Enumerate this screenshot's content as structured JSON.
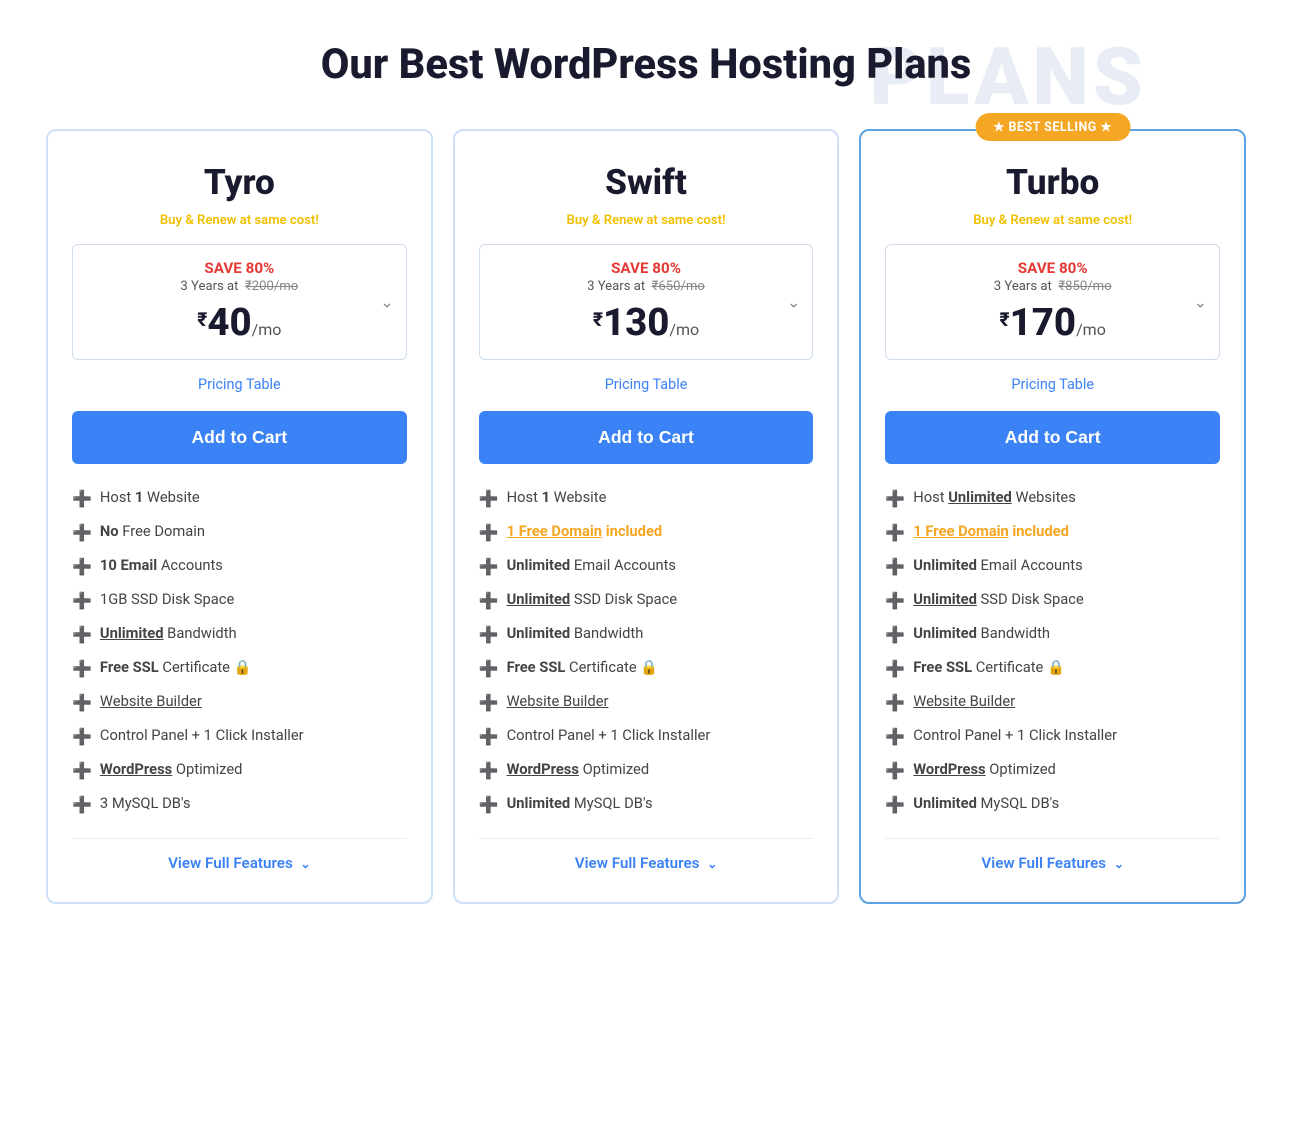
{
  "page": {
    "title": "Our Best WordPress Hosting Plans",
    "title_bg": "PLANS"
  },
  "plans": [
    {
      "id": "tyro",
      "name": "Tyro",
      "buy_renew": "Buy & Renew at same cost!",
      "save_label": "SAVE 80%",
      "years": "3 Years at",
      "original_price": "₹200/mo",
      "current_price": "40",
      "currency": "₹",
      "per_mo": "/mo",
      "pricing_table_label": "Pricing Table",
      "add_to_cart": "Add to Cart",
      "view_features": "View Full Features",
      "featured": false,
      "features": [
        {
          "text_parts": [
            {
              "text": "Host ",
              "style": "normal"
            },
            {
              "text": "1",
              "style": "bold"
            },
            {
              "text": " Website",
              "style": "normal"
            }
          ]
        },
        {
          "text_parts": [
            {
              "text": "No",
              "style": "bold"
            },
            {
              "text": " Free Domain",
              "style": "normal"
            }
          ]
        },
        {
          "text_parts": [
            {
              "text": "10 Email",
              "style": "bold"
            },
            {
              "text": " Accounts",
              "style": "normal"
            }
          ]
        },
        {
          "text_parts": [
            {
              "text": "1GB",
              "style": "normal"
            },
            {
              "text": " SSD Disk Space",
              "style": "normal"
            }
          ]
        },
        {
          "text_parts": [
            {
              "text": "Unlimited",
              "style": "bold-link"
            },
            {
              "text": " Bandwidth",
              "style": "normal"
            }
          ]
        },
        {
          "text_parts": [
            {
              "text": "Free SSL",
              "style": "bold"
            },
            {
              "text": " Certificate ",
              "style": "normal"
            },
            {
              "text": "🔒",
              "style": "icon"
            }
          ]
        },
        {
          "text_parts": [
            {
              "text": "Website Builder",
              "style": "link"
            }
          ]
        },
        {
          "text_parts": [
            {
              "text": "Control Panel + 1 Click Installer",
              "style": "normal"
            }
          ]
        },
        {
          "text_parts": [
            {
              "text": "WordPress",
              "style": "bold-link"
            },
            {
              "text": " Optimized",
              "style": "normal"
            }
          ]
        },
        {
          "text_parts": [
            {
              "text": "3",
              "style": "normal"
            },
            {
              "text": " MySQL DB's",
              "style": "normal"
            }
          ]
        }
      ]
    },
    {
      "id": "swift",
      "name": "Swift",
      "buy_renew": "Buy & Renew at same cost!",
      "save_label": "SAVE 80%",
      "years": "3 Years at",
      "original_price": "₹650/mo",
      "current_price": "130",
      "currency": "₹",
      "per_mo": "/mo",
      "pricing_table_label": "Pricing Table",
      "add_to_cart": "Add to Cart",
      "view_features": "View Full Features",
      "featured": false,
      "features": [
        {
          "text_parts": [
            {
              "text": "Host ",
              "style": "normal"
            },
            {
              "text": "1",
              "style": "bold"
            },
            {
              "text": " Website",
              "style": "normal"
            }
          ]
        },
        {
          "text_parts": [
            {
              "text": "1 Free Domain",
              "style": "orange-link"
            },
            {
              "text": " included",
              "style": "orange"
            }
          ]
        },
        {
          "text_parts": [
            {
              "text": "Unlimited",
              "style": "bold"
            },
            {
              "text": " Email Accounts",
              "style": "normal"
            }
          ]
        },
        {
          "text_parts": [
            {
              "text": "Unlimited",
              "style": "bold-link"
            },
            {
              "text": " SSD Disk Space",
              "style": "normal"
            }
          ]
        },
        {
          "text_parts": [
            {
              "text": "Unlimited",
              "style": "bold"
            },
            {
              "text": " Bandwidth",
              "style": "normal"
            }
          ]
        },
        {
          "text_parts": [
            {
              "text": "Free SSL",
              "style": "bold"
            },
            {
              "text": " Certificate ",
              "style": "normal"
            },
            {
              "text": "🔒",
              "style": "icon"
            }
          ]
        },
        {
          "text_parts": [
            {
              "text": "Website Builder",
              "style": "link"
            }
          ]
        },
        {
          "text_parts": [
            {
              "text": "Control Panel + 1 Click Installer",
              "style": "normal"
            }
          ]
        },
        {
          "text_parts": [
            {
              "text": "WordPress",
              "style": "bold-link"
            },
            {
              "text": " Optimized",
              "style": "normal"
            }
          ]
        },
        {
          "text_parts": [
            {
              "text": "Unlimited",
              "style": "bold"
            },
            {
              "text": " MySQL DB's",
              "style": "normal"
            }
          ]
        }
      ]
    },
    {
      "id": "turbo",
      "name": "Turbo",
      "buy_renew": "Buy & Renew at same cost!",
      "save_label": "SAVE 80%",
      "years": "3 Years at",
      "original_price": "₹850/mo",
      "current_price": "170",
      "currency": "₹",
      "per_mo": "/mo",
      "pricing_table_label": "Pricing Table",
      "add_to_cart": "Add to Cart",
      "view_features": "View Full Features",
      "featured": true,
      "best_selling_label": "★  BEST SELLING  ★",
      "features": [
        {
          "text_parts": [
            {
              "text": "Host ",
              "style": "normal"
            },
            {
              "text": "Unlimited",
              "style": "bold-link"
            },
            {
              "text": " Websites",
              "style": "normal"
            }
          ]
        },
        {
          "text_parts": [
            {
              "text": "1 Free Domain",
              "style": "orange-link"
            },
            {
              "text": " included",
              "style": "orange"
            }
          ]
        },
        {
          "text_parts": [
            {
              "text": "Unlimited",
              "style": "bold"
            },
            {
              "text": " Email Accounts",
              "style": "normal"
            }
          ]
        },
        {
          "text_parts": [
            {
              "text": "Unlimited",
              "style": "bold-link"
            },
            {
              "text": " SSD Disk Space",
              "style": "normal"
            }
          ]
        },
        {
          "text_parts": [
            {
              "text": "Unlimited",
              "style": "bold"
            },
            {
              "text": " Bandwidth",
              "style": "normal"
            }
          ]
        },
        {
          "text_parts": [
            {
              "text": "Free SSL",
              "style": "bold"
            },
            {
              "text": " Certificate ",
              "style": "normal"
            },
            {
              "text": "🔒",
              "style": "icon"
            }
          ]
        },
        {
          "text_parts": [
            {
              "text": "Website Builder",
              "style": "link"
            }
          ]
        },
        {
          "text_parts": [
            {
              "text": "Control Panel + 1 Click Installer",
              "style": "normal"
            }
          ]
        },
        {
          "text_parts": [
            {
              "text": "WordPress",
              "style": "bold-link"
            },
            {
              "text": " Optimized",
              "style": "normal"
            }
          ]
        },
        {
          "text_parts": [
            {
              "text": "Unlimited",
              "style": "bold"
            },
            {
              "text": " MySQL DB's",
              "style": "normal"
            }
          ]
        }
      ]
    }
  ]
}
